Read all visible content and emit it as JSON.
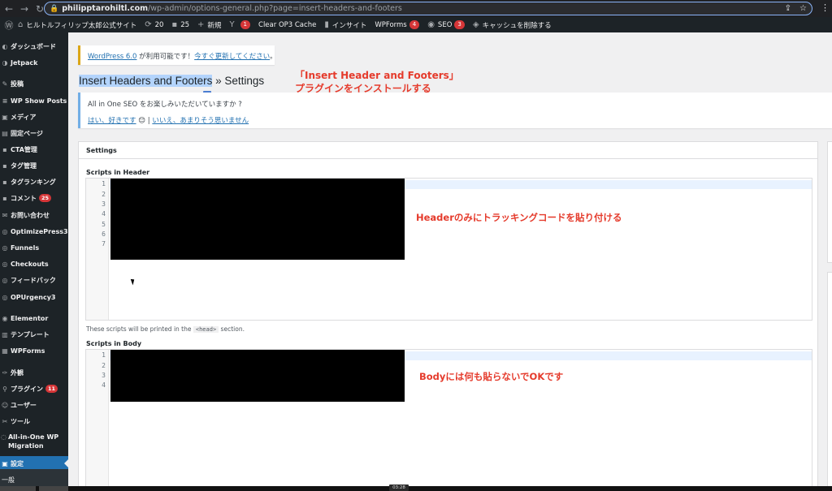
{
  "browser": {
    "url_host": "philipptarohiltl.com",
    "url_path": "/wp-admin/options-general.php?page=insert-headers-and-footers"
  },
  "admin_bar": {
    "site_name": "ヒルトルフィリップ太郎公式サイト",
    "updates_count": "20",
    "comments_count": "25",
    "new_label": "新規",
    "yoast_badge": "1",
    "clear_cache": "Clear OP3 Cache",
    "insights": "インサイト",
    "wpforms": "WPForms",
    "wpforms_badge": "4",
    "seo": "SEO",
    "seo_badge": "3",
    "purge_cache": "キャッシュを削除する"
  },
  "menu": {
    "items": [
      {
        "label": "ダッシュボード",
        "icon": "dashboard-icon"
      },
      {
        "label": "Jetpack",
        "icon": "jetpack-icon"
      },
      {
        "label": "投稿",
        "icon": "posts-icon"
      },
      {
        "label": "WP Show Posts",
        "icon": "list-icon"
      },
      {
        "label": "メディア",
        "icon": "media-icon"
      },
      {
        "label": "固定ページ",
        "icon": "page-icon"
      },
      {
        "label": "CTA管理",
        "icon": "cta-icon"
      },
      {
        "label": "タグ管理",
        "icon": "tag-icon"
      },
      {
        "label": "タグランキング",
        "icon": "ranking-icon"
      },
      {
        "label": "コメント",
        "icon": "comment-icon",
        "badge": "25"
      },
      {
        "label": "お問い合わせ",
        "icon": "mail-icon"
      },
      {
        "label": "OptimizePress3",
        "icon": "op-icon"
      },
      {
        "label": "Funnels",
        "icon": "funnel-icon"
      },
      {
        "label": "Checkouts",
        "icon": "checkout-icon"
      },
      {
        "label": "フィードバック",
        "icon": "feedback-icon"
      },
      {
        "label": "OPUrgency3",
        "icon": "urgency-icon"
      },
      {
        "label": "Elementor",
        "icon": "elementor-icon"
      },
      {
        "label": "テンプレート",
        "icon": "template-icon"
      },
      {
        "label": "WPForms",
        "icon": "wpforms-icon"
      },
      {
        "label": "外観",
        "icon": "appearance-icon"
      },
      {
        "label": "プラグイン",
        "icon": "plugin-icon",
        "badge": "11"
      },
      {
        "label": "ユーザー",
        "icon": "user-icon"
      },
      {
        "label": "ツール",
        "icon": "tools-icon"
      },
      {
        "label": "All-in-One WP Migration",
        "icon": "migration-icon"
      },
      {
        "label": "設定",
        "icon": "settings-icon"
      }
    ],
    "submenu_first": "一般"
  },
  "notice": {
    "wp_version_link": "WordPress 6.0",
    "middle_text": " が利用可能です！",
    "update_link": "今すぐ更新してください",
    "end": "。"
  },
  "page": {
    "title_highlight": "Insert Headers and Footers",
    "title_rest": " » Settings"
  },
  "annotations": {
    "top_line1": "「Insert Header and Footers」",
    "top_line2": "プラグインをインストールする",
    "header_note": "Headerのみにトラッキングコードを貼り付ける",
    "body_note": "Bodyには何も貼らないでOKです"
  },
  "aioseo_notice": {
    "question": "All in One SEO をお楽しみいただいていますか ?",
    "yes": "はい、好きです",
    "emoji": "😊",
    "sep": " | ",
    "no": "いいえ、あまりそう思いません"
  },
  "settings": {
    "panel_title": "Settings",
    "header_label": "Scripts in Header",
    "header_lines": [
      "1",
      "2",
      "3",
      "4",
      "5",
      "6",
      "7"
    ],
    "header_desc_before": "These scripts will be printed in the ",
    "header_desc_tag": "<head>",
    "header_desc_after": " section.",
    "body_label": "Scripts in Body",
    "body_lines": [
      "1",
      "2",
      "3",
      "4"
    ]
  },
  "video": {
    "timestamp": "03:28"
  }
}
